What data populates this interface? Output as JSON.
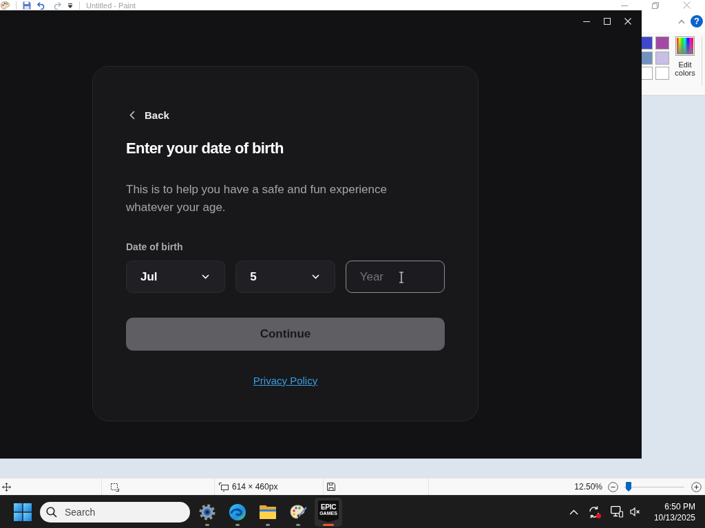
{
  "paint": {
    "title": "Untitled - Paint",
    "ribbon": {
      "help": "?",
      "swatches": [
        {
          "color": "#3f48cc"
        },
        {
          "color": "#a349a4"
        },
        {
          "color": "#7092be"
        },
        {
          "color": "#c8bfe7"
        },
        {
          "color": "#ffffff"
        },
        {
          "color": "#ffffff"
        }
      ],
      "edit_colors": "Edit colors"
    },
    "status_bar": {
      "canvas_size": "614 × 460px",
      "zoom": "12.50%",
      "zoom_slider": {
        "level": 0.08
      }
    }
  },
  "epic_window": {
    "back": "Back",
    "title": "Enter your date of birth",
    "description": "This is to help you have a safe and fun experience whatever your age.",
    "dob_label": "Date of birth",
    "fields": [
      {
        "kind": "select",
        "value": "Jul",
        "hovered": false
      },
      {
        "kind": "select",
        "value": "5",
        "hovered": false
      },
      {
        "kind": "input",
        "placeholder": "Year",
        "hovered": true
      }
    ],
    "continue_button": {
      "label": "Continue",
      "disabled": true
    },
    "privacy_link": "Privacy Policy"
  },
  "taskbar": {
    "search": {
      "placeholder": "Search"
    },
    "apps": [
      {
        "kind": "settings",
        "selected": false
      },
      {
        "kind": "browser",
        "selected": false
      },
      {
        "kind": "folder",
        "selected": false
      },
      {
        "kind": "paint",
        "selected": false
      },
      {
        "kind": "logo",
        "selected": true,
        "logo_text": [
          "EPIC",
          "GAMES"
        ]
      }
    ],
    "clock": {
      "time": "6:50 PM",
      "date": "10/13/2025"
    }
  }
}
